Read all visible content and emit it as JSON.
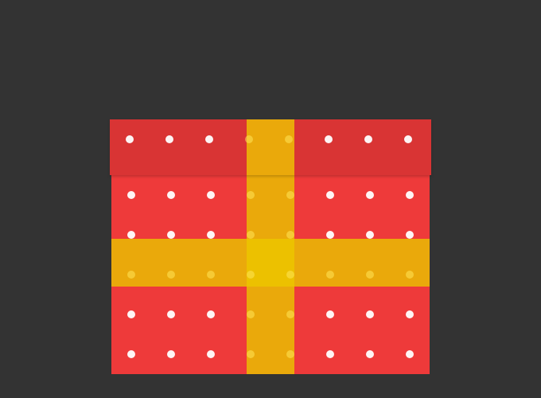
{
  "scene": {
    "subject": "gift-box",
    "colors": {
      "background": "#333333",
      "box": "#ee3a3a",
      "lid": "#d93434",
      "ribbon": "#eaa90b",
      "ribbon_knot": "#ecc100",
      "dots": "#ffffff"
    },
    "pattern": "polka-dots"
  }
}
